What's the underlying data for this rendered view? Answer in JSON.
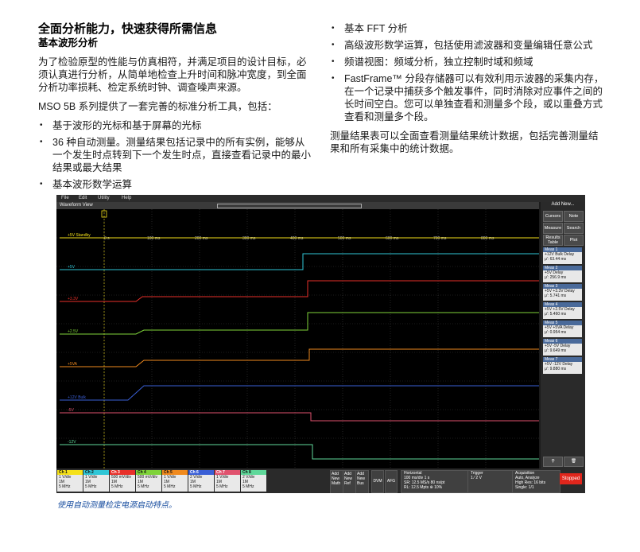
{
  "doc": {
    "title": "全面分析能力，快速获得所需信息",
    "subtitle": "基本波形分析",
    "para1": "为了检验原型的性能与仿真相符，并满足项目的设计目标，必须认真进行分析，从简单地检查上升时间和脉冲宽度，到全面分析功率损耗、检定系统时钟、调查噪声来源。",
    "para2": "MSO 5B 系列提供了一套完善的标准分析工具，包括：",
    "left_bullets": [
      "基于波形的光标和基于屏幕的光标",
      "36 种自动测量。测量结果包括记录中的所有实例，能够从一个发生时点转到下一个发生时点，直接查看记录中的最小结果或最大结果",
      "基本波形数学运算"
    ],
    "right_bullets": [
      "基本 FFT 分析",
      "高级波形数学运算，包括使用滤波器和变量编辑任意公式",
      "频谱视图：频域分析，独立控制时域和频域",
      "FastFrame™ 分段存储器可以有效利用示波器的采集内存，在一个记录中捕获多个触发事件，同时消除对应事件之间的长时间空白。您可以单独查看和测量多个段，或以重叠方式查看和测量多个段。"
    ],
    "para3": "测量结果表可以全面查看测量结果统计数据，包括完善测量结果和所有采集中的统计数据。",
    "caption": "使用自动测量检定电源启动特点。"
  },
  "scope": {
    "menu": [
      "File",
      "Edit",
      "Utility",
      "Help"
    ],
    "view_title": "Waveform View",
    "time_labels": [
      "0 s",
      "100 ms",
      "200 ms",
      "300 ms",
      "400 ms",
      "500 ms",
      "600 ms",
      "700 ms",
      "800 ms"
    ],
    "trace_labels": [
      "+5V Standby",
      "+5V",
      "+3.3V",
      "+2.5V",
      "+5VA",
      "+12V Bulk",
      "-5V",
      "-12V"
    ],
    "add_new": "Add New...",
    "buttons": [
      "Cursors",
      "Note",
      "Measure",
      "Search",
      "Results Table",
      "Plot"
    ],
    "measurements": [
      {
        "name": "Meas 1",
        "label": "+12V Bulk Delay",
        "value": "μ': 63.44 ms"
      },
      {
        "name": "Meas 2",
        "label": "+5V Delay",
        "value": "μ': 256.9 ms"
      },
      {
        "name": "Meas 3",
        "label": "+5V +3.3V Delay",
        "value": "μ': 5.741 ms"
      },
      {
        "name": "Meas 4",
        "label": "+5V +2.5V Delay",
        "value": "μ': 5.460 ms"
      },
      {
        "name": "Meas 5",
        "label": "+5V +5VA Delay",
        "value": "μ': 0.954 ms"
      },
      {
        "name": "Meas 6",
        "label": "+5V -5V Delay",
        "value": "μ': 9.649 ms"
      },
      {
        "name": "Meas 7",
        "label": "+5V -12V Delay",
        "value": "μ': 9.880 ms"
      }
    ],
    "channels": [
      {
        "name": "Ch 1",
        "l1": "1 V/div",
        "l2": "1M",
        "l3": "5 MHz",
        "color": "#f5e11a"
      },
      {
        "name": "Ch 2",
        "l1": "1 V/div",
        "l2": "1M",
        "l3": "5 MHz",
        "color": "#2fc6d6"
      },
      {
        "name": "Ch 3",
        "l1": "500 mV/div",
        "l2": "1M",
        "l3": "5 MHz",
        "color": "#e8302a"
      },
      {
        "name": "Ch 4",
        "l1": "500 mV/div",
        "l2": "1M",
        "l3": "5 MHz",
        "color": "#7fd33a"
      },
      {
        "name": "Ch 5",
        "l1": "1 V/div",
        "l2": "1M",
        "l3": "5 MHz",
        "color": "#f08a1e"
      },
      {
        "name": "Ch 6",
        "l1": "2 V/div",
        "l2": "1M",
        "l3": "5 MHz",
        "color": "#3a5fd6"
      },
      {
        "name": "Ch 7",
        "l1": "1 V/div",
        "l2": "1M",
        "l3": "5 MHz",
        "color": "#e0526e"
      },
      {
        "name": "Ch 8",
        "l1": "2 V/div",
        "l2": "1M",
        "l3": "5 MHz",
        "color": "#5fd89a"
      }
    ],
    "add_math": "Add New Math",
    "add_ref": "Add New Ref",
    "add_bus": "Add New Bus",
    "dvm": "DVM",
    "afg": "AFG",
    "horizontal": {
      "title": "Horizontal",
      "l1": "100 ms/div    1 s",
      "l2": "SR: 12.5 MS/s    80 ns/pt",
      "l3": "RL: 12.5 Mpts  ⊕  10%"
    },
    "trigger": {
      "title": "Trigger",
      "l1": "1  ⁄  2 V"
    },
    "acquisition": {
      "title": "Acquisition",
      "l1": "Auto,    Analyze",
      "l2": "High Res: 16 bits",
      "l3": "Single: 1/1"
    },
    "stopped": "Stopped"
  }
}
